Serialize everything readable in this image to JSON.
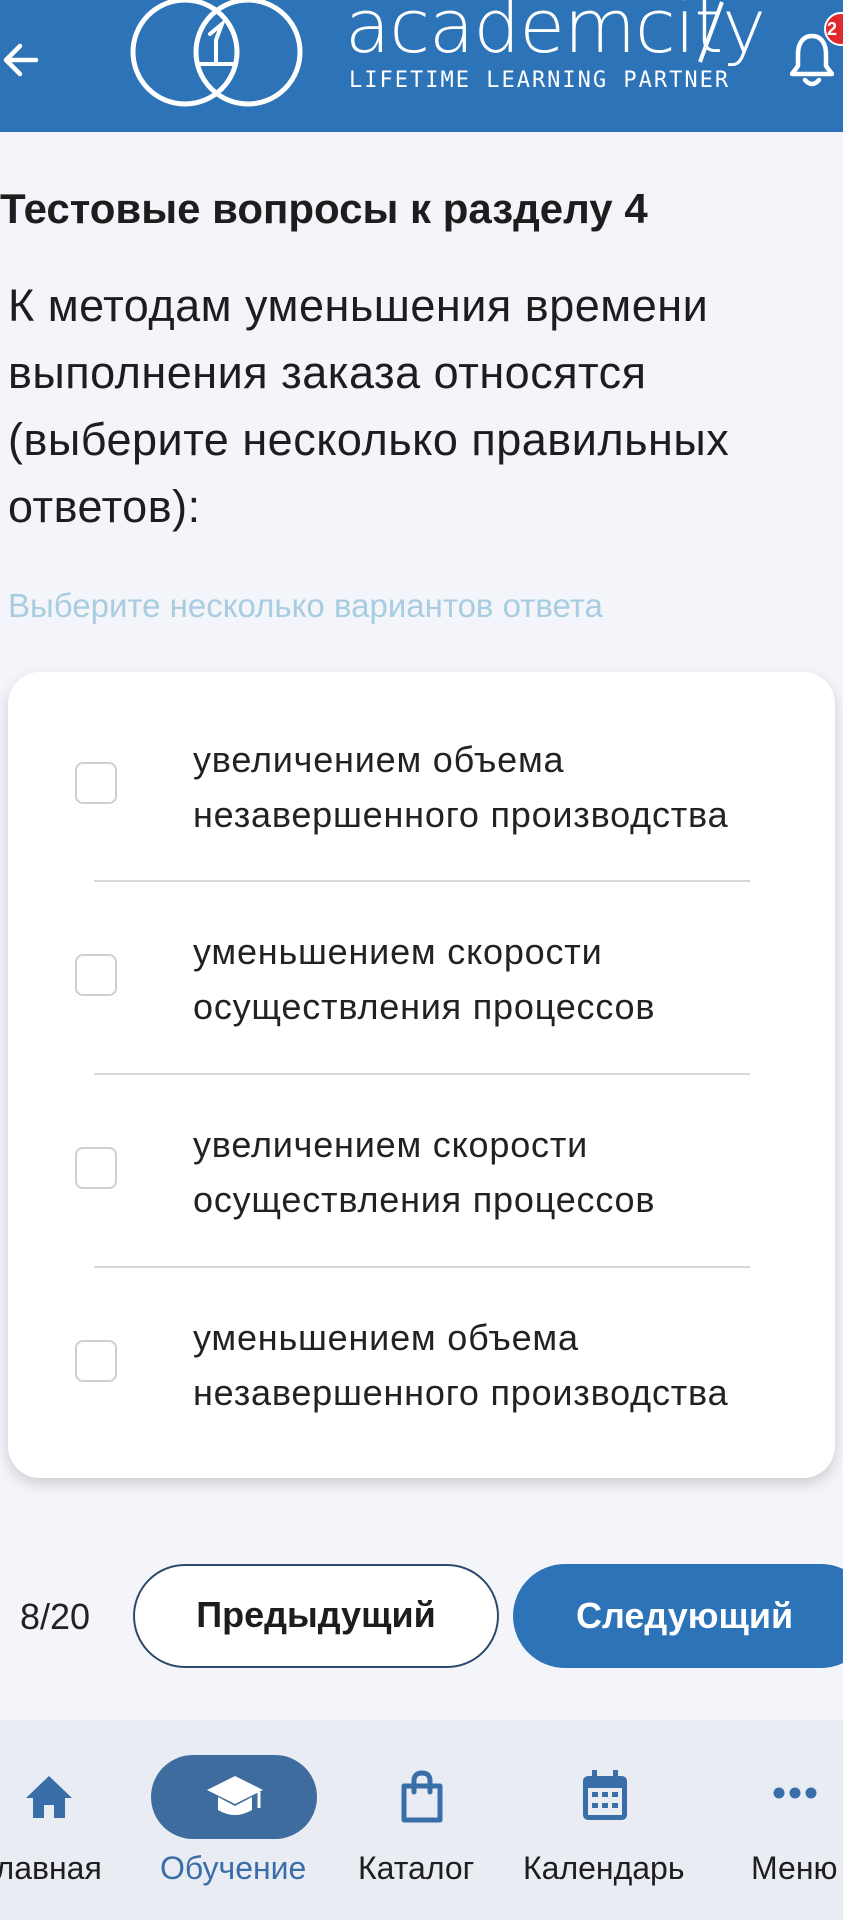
{
  "header": {
    "brand_name": "academcity",
    "tagline": "LIFETIME LEARNING PARTNER",
    "notification_count": "2",
    "back_icon": "arrow-left-icon",
    "bell_icon": "bell-icon"
  },
  "quiz": {
    "section_title": "Тестовые вопросы к разделу 4",
    "question": "К методам уменьшения времени выполнения заказа относятся (выберите несколько правильных ответов):",
    "hint": "Выберите несколько вариантов ответа",
    "options": [
      {
        "line1": "увеличением объема",
        "line2": "незавершенного производства",
        "checked": false
      },
      {
        "line1": "уменьшением скорости",
        "line2": "осуществления процессов",
        "checked": false
      },
      {
        "line1": "увеличением скорости",
        "line2": "осуществления процессов",
        "checked": false
      },
      {
        "line1": "уменьшением объема",
        "line2": "незавершенного производства",
        "checked": false
      }
    ]
  },
  "pager": {
    "counter": "8/20",
    "prev_label": "Предыдущий",
    "next_label": "Следующий"
  },
  "bottom_nav": {
    "items": [
      {
        "label": "Главная",
        "icon": "home-icon",
        "active": false
      },
      {
        "label": "Обучение",
        "icon": "graduation-cap-icon",
        "active": true
      },
      {
        "label": "Каталог",
        "icon": "shopping-bag-icon",
        "active": false
      },
      {
        "label": "Календарь",
        "icon": "calendar-icon",
        "active": false
      },
      {
        "label": "Меню",
        "icon": "more-dots-icon",
        "active": false
      }
    ]
  },
  "colors": {
    "brand_blue": "#2d73b8",
    "hint_text": "#a8cde0",
    "active_nav": "#3f6c9e",
    "badge_red": "#e0282d"
  }
}
